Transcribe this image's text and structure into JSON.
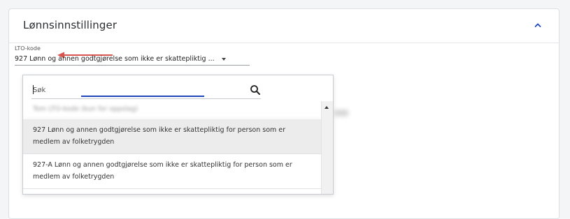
{
  "section": {
    "title": "Lønnsinnstillinger",
    "collapse_icon": "chevron-up-icon",
    "accent_color": "#1f47b8"
  },
  "lto_field": {
    "label": "LTO-kode",
    "value": "927 Lønn og annen godtgjørelse som ikke er skattepliktig ...",
    "annotation_arrow_color": "#d9534f"
  },
  "dropdown": {
    "search_placeholder": "Søk",
    "search_value": "",
    "search_icon": "search-icon",
    "options": [
      {
        "label": "Tom LTO-kode (kun for oppslag)",
        "state": "blurred"
      },
      {
        "label": "927 Lønn og annen godtgjørelse som ikke er skattepliktig for person som er medlem av folketrygden",
        "state": "selected"
      },
      {
        "label": "927-A Lønn og annen godtgjørelse som ikke er skattepliktig for person som er medlem av folketrygden",
        "state": "normal"
      }
    ]
  }
}
